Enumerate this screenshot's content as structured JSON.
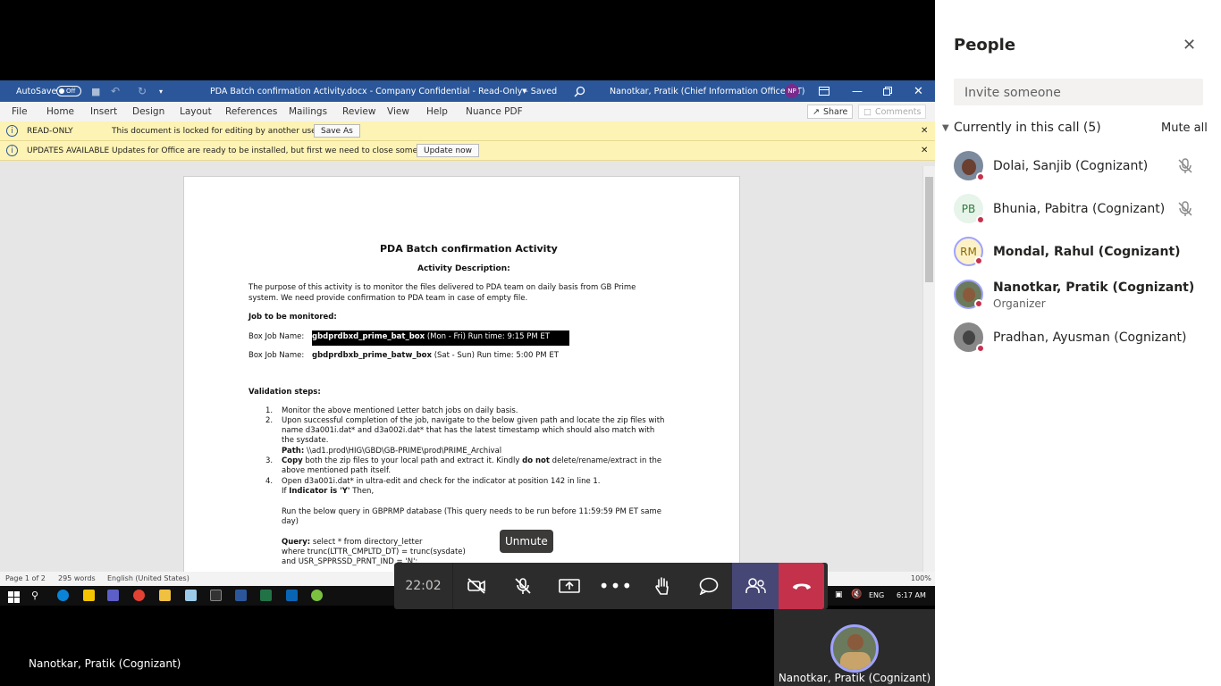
{
  "word": {
    "autosave_label": "AutoSave",
    "autosave_state": "Off",
    "doc_title": "PDA Batch confirmation Activity.docx - Company Confidential - Read-Only - Saved",
    "user": "Nanotkar, Pratik (Chief Information Office - IT)",
    "user_initials": "NP",
    "menu": [
      "File",
      "Home",
      "Insert",
      "Design",
      "Layout",
      "References",
      "Mailings",
      "Review",
      "View",
      "Help",
      "Nuance PDF"
    ],
    "share_label": "Share",
    "comments_label": "Comments",
    "readonly_title": "READ-ONLY",
    "readonly_msg": "This document is locked for editing by another user.",
    "save_as_label": "Save As",
    "updates_title": "UPDATES AVAILABLE",
    "updates_msg": "Updates for Office are ready to be installed, but first we need to close some apps.",
    "update_now_label": "Update now",
    "status_page": "Page 1 of 2",
    "status_words": "295 words",
    "status_lang": "English (United States)",
    "zoom": "100%"
  },
  "doc": {
    "title": "PDA Batch confirmation Activity",
    "subtitle": "Activity Description:",
    "purpose_1": "The purpose of this activity is to monitor the files delivered to PDA team on daily basis from GB Prime",
    "purpose_2": "system. We need provide confirmation to PDA team in case of empty file.",
    "job_heading": "Job to be monitored:",
    "box1_label": "Box Job Name:",
    "box1_job": "gbdprdbxd_prime_bat_box",
    "box1_rest": "(Mon - Fri) Run time: 9:15 PM ET",
    "box2_label": "Box Job Name:",
    "box2_job": "gbdprdbxb_prime_batw_box",
    "box2_rest": "(Sat - Sun) Run time: 5:00 PM ET",
    "validation_heading": "Validation steps:",
    "s1_num": "1.",
    "s1": "Monitor the above mentioned Letter batch jobs on daily basis.",
    "s2_num": "2.",
    "s2a": "Upon successful completion of the job, navigate to the below given path and locate the zip files with",
    "s2b": "name d3a001i.dat* and d3a002i.dat* that has the latest timestamp which should also match with",
    "s2c": "the sysdate.",
    "path_label": "Path:",
    "path_value": "\\\\ad1.prod\\HIG\\GBD\\GB-PRIME\\prod\\PRIME_Archival",
    "s3_num": "3.",
    "s3_copy": "Copy",
    "s3a": "both the zip files to your local path and extract it. Kindly",
    "s3_donot": "do not",
    "s3b": "delete/rename/extract in the",
    "s3c": "above mentioned path itself.",
    "s4_num": "4.",
    "s4a": "Open d3a001i.dat* in ultra-edit and check for the indicator at position 142 in line 1.",
    "s4_if": "If",
    "s4_ind": "Indicator is 'Y'",
    "s4_then": "Then,",
    "run_a": "Run the below query in GBPRMP database (This query needs to be run before 11:59:59 PM ET same",
    "run_b": "day)",
    "query_label": "Query:",
    "query_1": "select * from directory_letter",
    "query_2": "where trunc(LTTR_CMPLTD_DT) = trunc(sysdate)",
    "query_3": "and USR_SPPRSSD_PRNT_IND = 'N';"
  },
  "taskbar": {
    "lang": "ENG",
    "time": "6:17 AM"
  },
  "call": {
    "duration": "22:02",
    "unmute_tooltip": "Unmute",
    "presenter_label": "Nanotkar, Pratik (Cognizant)",
    "self_label": "Nanotkar, Pratik (Cognizant)"
  },
  "people": {
    "title": "People",
    "invite_placeholder": "Invite someone",
    "section_label": "Currently in this call (5)",
    "mute_all_label": "Mute all",
    "members": [
      {
        "name": "Dolai, Sanjib (Cognizant)",
        "initials": ""
      },
      {
        "name": "Bhunia, Pabitra (Cognizant)",
        "initials": "PB"
      },
      {
        "name": "Mondal, Rahul (Cognizant)",
        "initials": "RM"
      },
      {
        "name": "Nanotkar, Pratik (Cognizant)",
        "initials": "",
        "role": "Organizer"
      },
      {
        "name": "Pradhan, Ayusman (Cognizant)",
        "initials": ""
      }
    ]
  },
  "colors": {
    "word_blue": "#2b579a",
    "hangup": "#c4314b",
    "teams_purple": "#464775",
    "yellow_bar": "#fdf3b4"
  }
}
